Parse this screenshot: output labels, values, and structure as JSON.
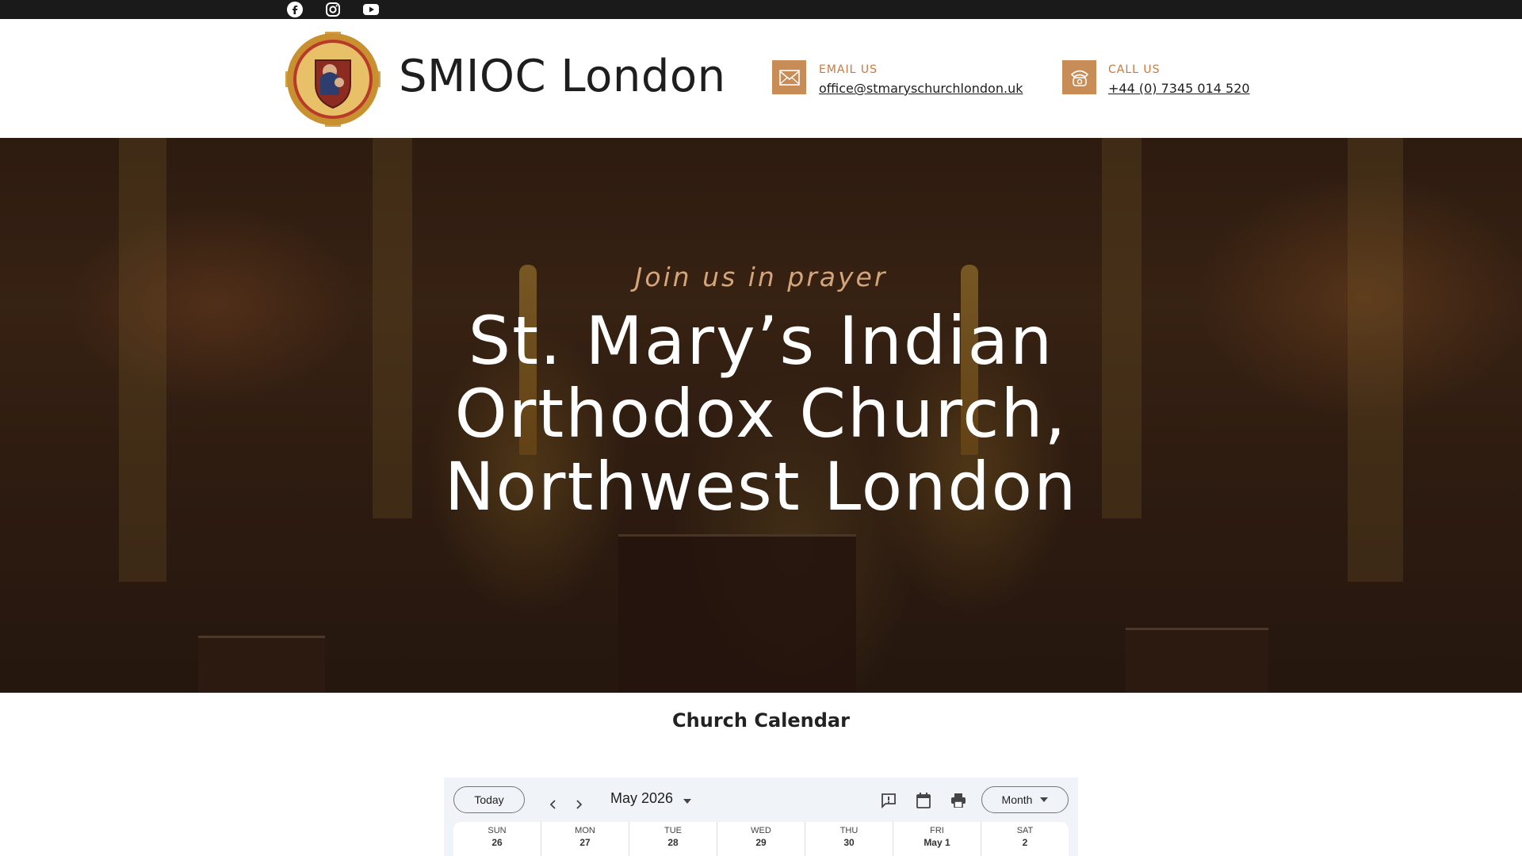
{
  "social": [
    {
      "icon": "facebook-icon"
    },
    {
      "icon": "instagram-icon"
    },
    {
      "icon": "youtube-icon"
    }
  ],
  "header": {
    "site_title": "SMIOC London",
    "email": {
      "label": "EMAIL US",
      "value": "office@stmaryschurchlondon.uk",
      "icon": "envelope-icon"
    },
    "phone": {
      "label": "CALL US",
      "value": "+44 (0) 7345 014 520",
      "icon": "telephone-icon"
    }
  },
  "hero": {
    "subtitle": "Join us in prayer",
    "title": "St. Mary’s Indian Orthodox Church, Northwest London"
  },
  "calendar_section": {
    "heading": "Church Calendar",
    "toolbar": {
      "today_label": "Today",
      "month_label": "May 2026",
      "view_label": "Month"
    },
    "days": [
      {
        "name": "SUN",
        "num": "26"
      },
      {
        "name": "MON",
        "num": "27"
      },
      {
        "name": "TUE",
        "num": "28"
      },
      {
        "name": "WED",
        "num": "29"
      },
      {
        "name": "THU",
        "num": "30"
      },
      {
        "name": "FRI",
        "num": "May 1"
      },
      {
        "name": "SAT",
        "num": "2"
      }
    ]
  },
  "colors": {
    "accent": "#c88c57",
    "topbar": "#1a1a1a",
    "calendar_bg": "#f0f4f9"
  }
}
